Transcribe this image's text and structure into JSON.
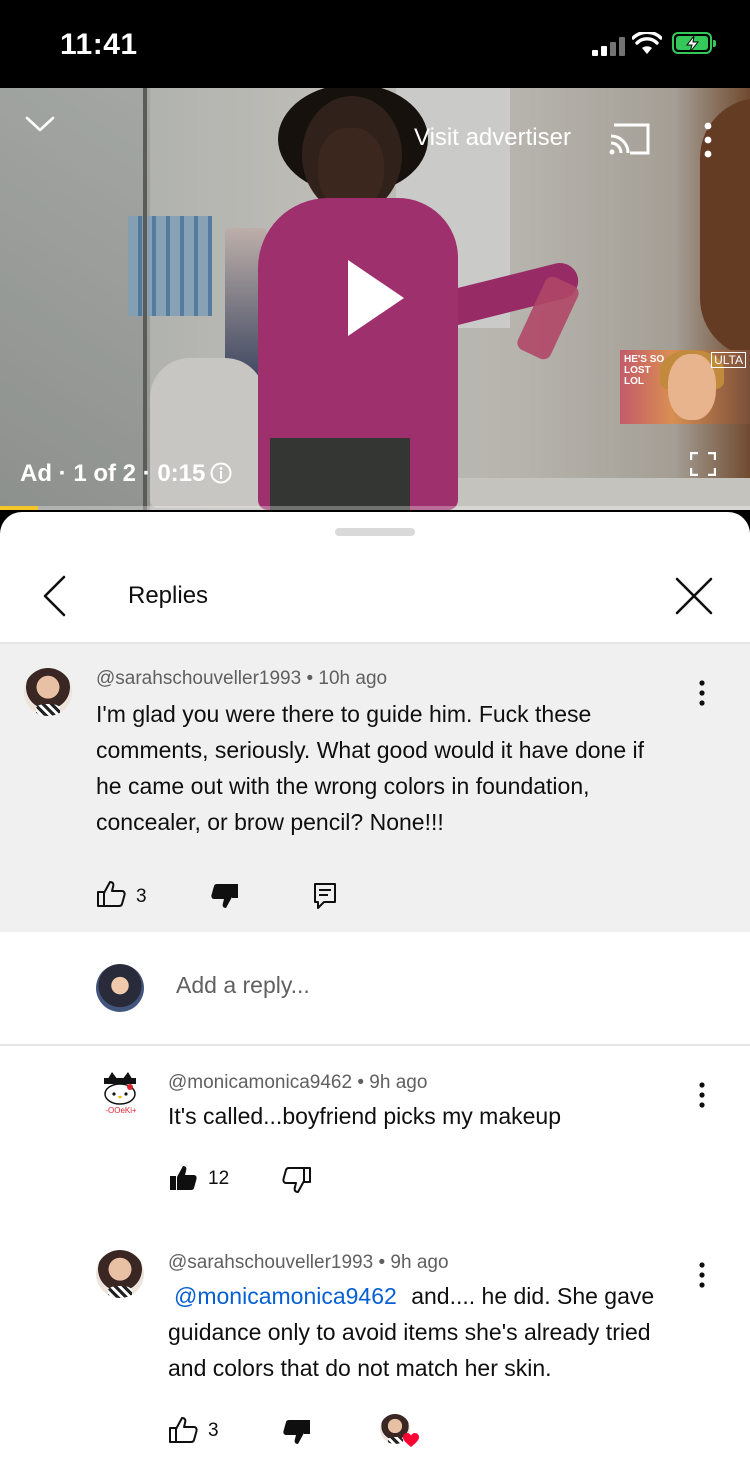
{
  "status_bar": {
    "time": "11:41"
  },
  "video": {
    "visit_advertiser": "Visit advertiser",
    "ad_label": "Ad · 1 of 2 · 0:15",
    "progress": 0.05,
    "thumbnail": {
      "caption": "HE'S SO LOST LOL",
      "brand": "ULTA"
    }
  },
  "header": {
    "title": "Replies"
  },
  "parent_comment": {
    "author": "@sarahschouveller1993",
    "age": "10h ago",
    "text_lines": [
      "I'm glad you were there to guide him. Fuck these",
      "comments, seriously.  What good would it have done if",
      "he came out with the wrong colors in foundation,",
      "concealer, or brow pencil? None!!!"
    ],
    "likes": "3"
  },
  "reply_box": {
    "placeholder": "Add a reply..."
  },
  "replies": [
    {
      "author": "@monicamonica9462",
      "age": "9h ago",
      "text": "It's called...boyfriend picks my makeup",
      "likes": "12",
      "avatar_label": "-OOeKi+"
    },
    {
      "author": "@sarahschouveller1993",
      "age": "9h ago",
      "mention": "@monicamonica9462",
      "text_line1_rest": "and.... he did. She gave",
      "text_line2": "guidance only to avoid items she's already tried",
      "text_line3": "and colors that do not match her skin.",
      "likes": "3"
    }
  ],
  "colors": {
    "accent_link": "#065fd4",
    "ad_progress": "#f4c62a",
    "battery": "#34c759",
    "heart": "#ff0033"
  }
}
